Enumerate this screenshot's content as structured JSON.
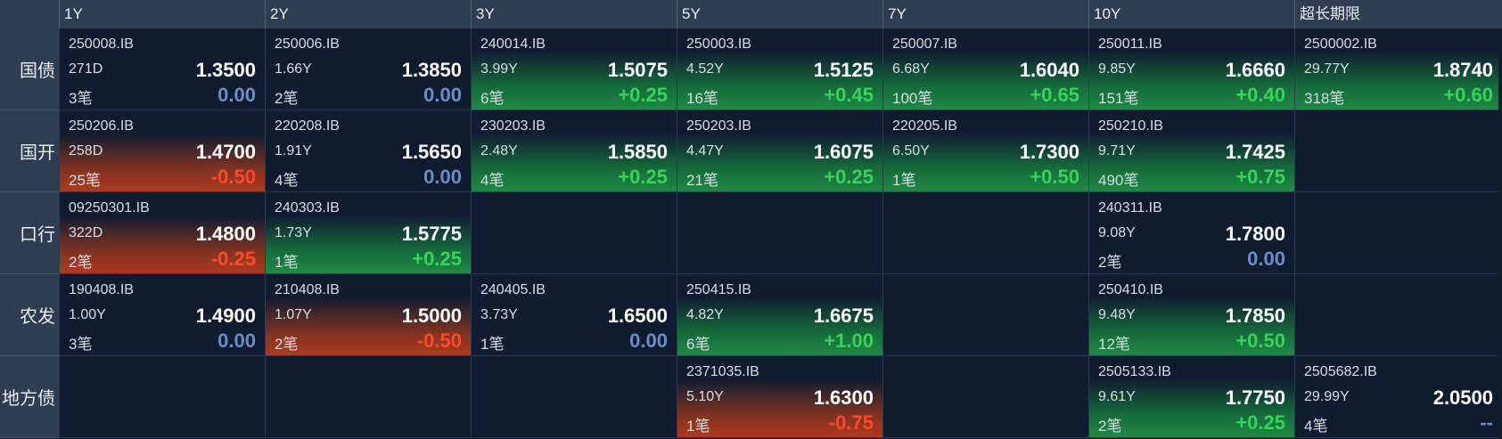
{
  "columns": [
    "1Y",
    "2Y",
    "3Y",
    "5Y",
    "7Y",
    "10Y",
    "超长期限"
  ],
  "rows": [
    {
      "label": "国债",
      "cells": [
        {
          "code": "250008.IB",
          "term": "271D",
          "count": "3笔",
          "yield": "1.3500",
          "change": "0.00",
          "dir": "zero"
        },
        {
          "code": "250006.IB",
          "term": "1.66Y",
          "count": "2笔",
          "yield": "1.3850",
          "change": "0.00",
          "dir": "zero"
        },
        {
          "code": "240014.IB",
          "term": "3.99Y",
          "count": "6笔",
          "yield": "1.5075",
          "change": "+0.25",
          "dir": "pos"
        },
        {
          "code": "250003.IB",
          "term": "4.52Y",
          "count": "16笔",
          "yield": "1.5125",
          "change": "+0.45",
          "dir": "pos"
        },
        {
          "code": "250007.IB",
          "term": "6.68Y",
          "count": "100笔",
          "yield": "1.6040",
          "change": "+0.65",
          "dir": "pos"
        },
        {
          "code": "250011.IB",
          "term": "9.85Y",
          "count": "151笔",
          "yield": "1.6660",
          "change": "+0.40",
          "dir": "pos"
        },
        {
          "code": "2500002.IB",
          "term": "29.77Y",
          "count": "318笔",
          "yield": "1.8740",
          "change": "+0.60",
          "dir": "pos"
        }
      ]
    },
    {
      "label": "国开",
      "cells": [
        {
          "code": "250206.IB",
          "term": "258D",
          "count": "25笔",
          "yield": "1.4700",
          "change": "-0.50",
          "dir": "neg"
        },
        {
          "code": "220208.IB",
          "term": "1.91Y",
          "count": "4笔",
          "yield": "1.5650",
          "change": "0.00",
          "dir": "zero"
        },
        {
          "code": "230203.IB",
          "term": "2.48Y",
          "count": "4笔",
          "yield": "1.5850",
          "change": "+0.25",
          "dir": "pos"
        },
        {
          "code": "250203.IB",
          "term": "4.47Y",
          "count": "21笔",
          "yield": "1.6075",
          "change": "+0.25",
          "dir": "pos"
        },
        {
          "code": "220205.IB",
          "term": "6.50Y",
          "count": "1笔",
          "yield": "1.7300",
          "change": "+0.50",
          "dir": "pos"
        },
        {
          "code": "250210.IB",
          "term": "9.71Y",
          "count": "490笔",
          "yield": "1.7425",
          "change": "+0.75",
          "dir": "pos"
        },
        null
      ]
    },
    {
      "label": "口行",
      "cells": [
        {
          "code": "09250301.IB",
          "term": "322D",
          "count": "2笔",
          "yield": "1.4800",
          "change": "-0.25",
          "dir": "neg"
        },
        {
          "code": "240303.IB",
          "term": "1.73Y",
          "count": "1笔",
          "yield": "1.5775",
          "change": "+0.25",
          "dir": "pos"
        },
        null,
        null,
        null,
        {
          "code": "240311.IB",
          "term": "9.08Y",
          "count": "2笔",
          "yield": "1.7800",
          "change": "0.00",
          "dir": "zero"
        },
        null
      ]
    },
    {
      "label": "农发",
      "cells": [
        {
          "code": "190408.IB",
          "term": "1.00Y",
          "count": "3笔",
          "yield": "1.4900",
          "change": "0.00",
          "dir": "zero"
        },
        {
          "code": "210408.IB",
          "term": "1.07Y",
          "count": "2笔",
          "yield": "1.5000",
          "change": "-0.50",
          "dir": "neg"
        },
        {
          "code": "240405.IB",
          "term": "3.73Y",
          "count": "1笔",
          "yield": "1.6500",
          "change": "0.00",
          "dir": "zero"
        },
        {
          "code": "250415.IB",
          "term": "4.82Y",
          "count": "6笔",
          "yield": "1.6675",
          "change": "+1.00",
          "dir": "pos"
        },
        null,
        {
          "code": "250410.IB",
          "term": "9.48Y",
          "count": "12笔",
          "yield": "1.7850",
          "change": "+0.50",
          "dir": "pos"
        },
        null
      ]
    },
    {
      "label": "地方债",
      "cells": [
        null,
        null,
        null,
        {
          "code": "2371035.IB",
          "term": "5.10Y",
          "count": "1笔",
          "yield": "1.6300",
          "change": "-0.75",
          "dir": "neg"
        },
        null,
        {
          "code": "2505133.IB",
          "term": "9.61Y",
          "count": "2笔",
          "yield": "1.7750",
          "change": "+0.25",
          "dir": "pos"
        },
        {
          "code": "2505682.IB",
          "term": "29.99Y",
          "count": "4笔",
          "yield": "2.0500",
          "change": "--",
          "dir": "na"
        }
      ]
    }
  ]
}
